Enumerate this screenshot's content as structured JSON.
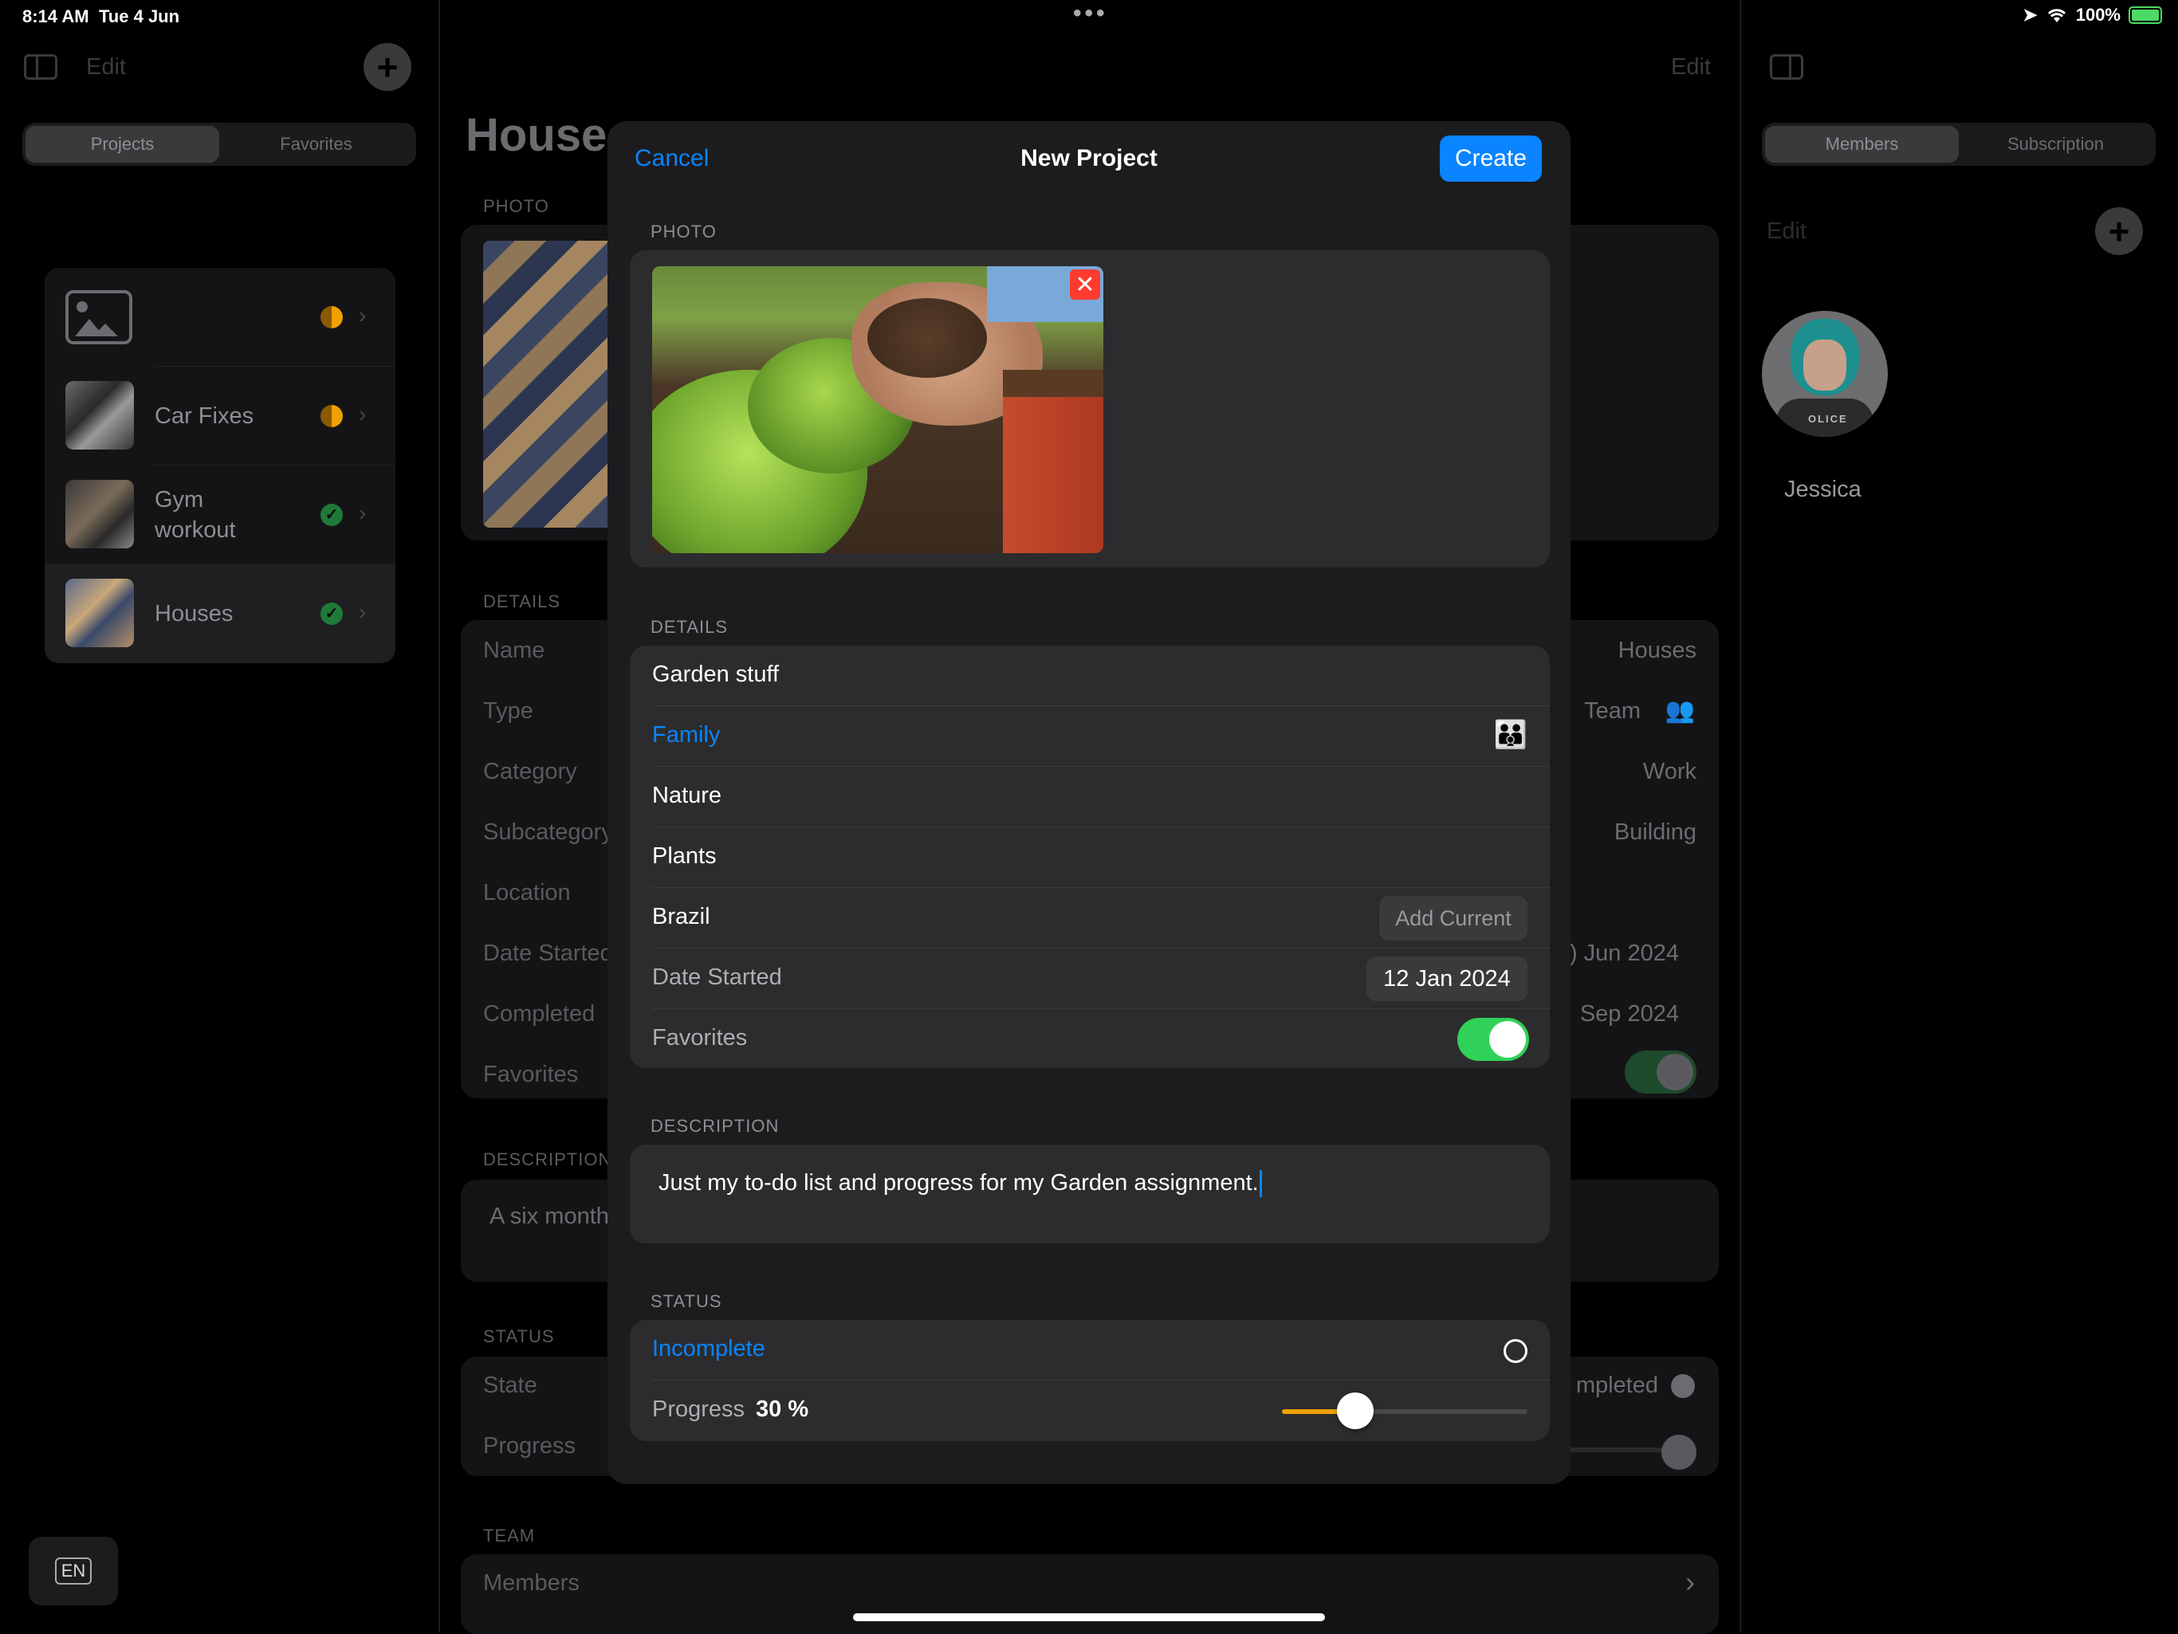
{
  "status_bar": {
    "time": "8:14 AM",
    "date": "Tue 4 Jun",
    "battery": "100%"
  },
  "sidebar": {
    "edit_label": "Edit",
    "segments": [
      "Projects",
      "Favorites"
    ],
    "selected_segment": "Projects",
    "projects": [
      {
        "label": "",
        "status": "half",
        "status_color": "#f0a000"
      },
      {
        "label": "Car Fixes",
        "status": "half",
        "status_color": "#f0a000"
      },
      {
        "label": "Gym\nworkout",
        "status": "done",
        "status_color": "#30d158"
      },
      {
        "label": "Houses",
        "status": "done",
        "status_color": "#30d158"
      }
    ],
    "keyboard_label": "EN"
  },
  "detail": {
    "title": "House",
    "edit_label": "Edit",
    "photo_caption": "PHOTO",
    "details_caption": "DETAILS",
    "rows": [
      {
        "label": "Name",
        "value": "Houses"
      },
      {
        "label": "Type",
        "value": "Team"
      },
      {
        "label": "Category",
        "value": "Work"
      },
      {
        "label": "Subcategory",
        "value": "Building"
      },
      {
        "label": "Location",
        "value": ""
      },
      {
        "label": "Date Started",
        "value": ") Jun 2024"
      },
      {
        "label": "Completed",
        "value": "Sep 2024"
      },
      {
        "label": "Favorites",
        "value": ""
      }
    ],
    "description_caption": "DESCRIPTION",
    "description_text": "A six month",
    "status_caption": "STATUS",
    "state_label": "State",
    "state_value": "mpleted",
    "progress_label": "Progress",
    "team_caption": "TEAM",
    "members_label": "Members"
  },
  "inspector": {
    "segments": [
      "Members",
      "Subscription"
    ],
    "selected_segment": "Members",
    "edit_label": "Edit",
    "member_name": "Jessica",
    "avatar_badge_text": "OLICE"
  },
  "modal": {
    "cancel_label": "Cancel",
    "title": "New Project",
    "create_label": "Create",
    "photo_caption": "PHOTO",
    "details_caption": "DETAILS",
    "name_value": "Garden stuff",
    "type_value": "Family",
    "category_value": "Nature",
    "subcategory_value": "Plants",
    "location_value": "Brazil",
    "add_current_label": "Add Current",
    "date_label": "Date Started",
    "date_value": "12 Jan 2024",
    "favorites_label": "Favorites",
    "favorites_on": true,
    "description_caption": "DESCRIPTION",
    "description_text": "Just my to-do list and progress for my Garden assignment.",
    "status_caption": "STATUS",
    "state_value": "Incomplete",
    "progress_label": "Progress",
    "progress_value": "30 %",
    "progress_fraction": 0.3,
    "colors": {
      "accent": "#0a84ff",
      "toggle_on": "#30d158",
      "slider_fill": "#f0a000",
      "remove_photo": "#ff3b30"
    }
  }
}
